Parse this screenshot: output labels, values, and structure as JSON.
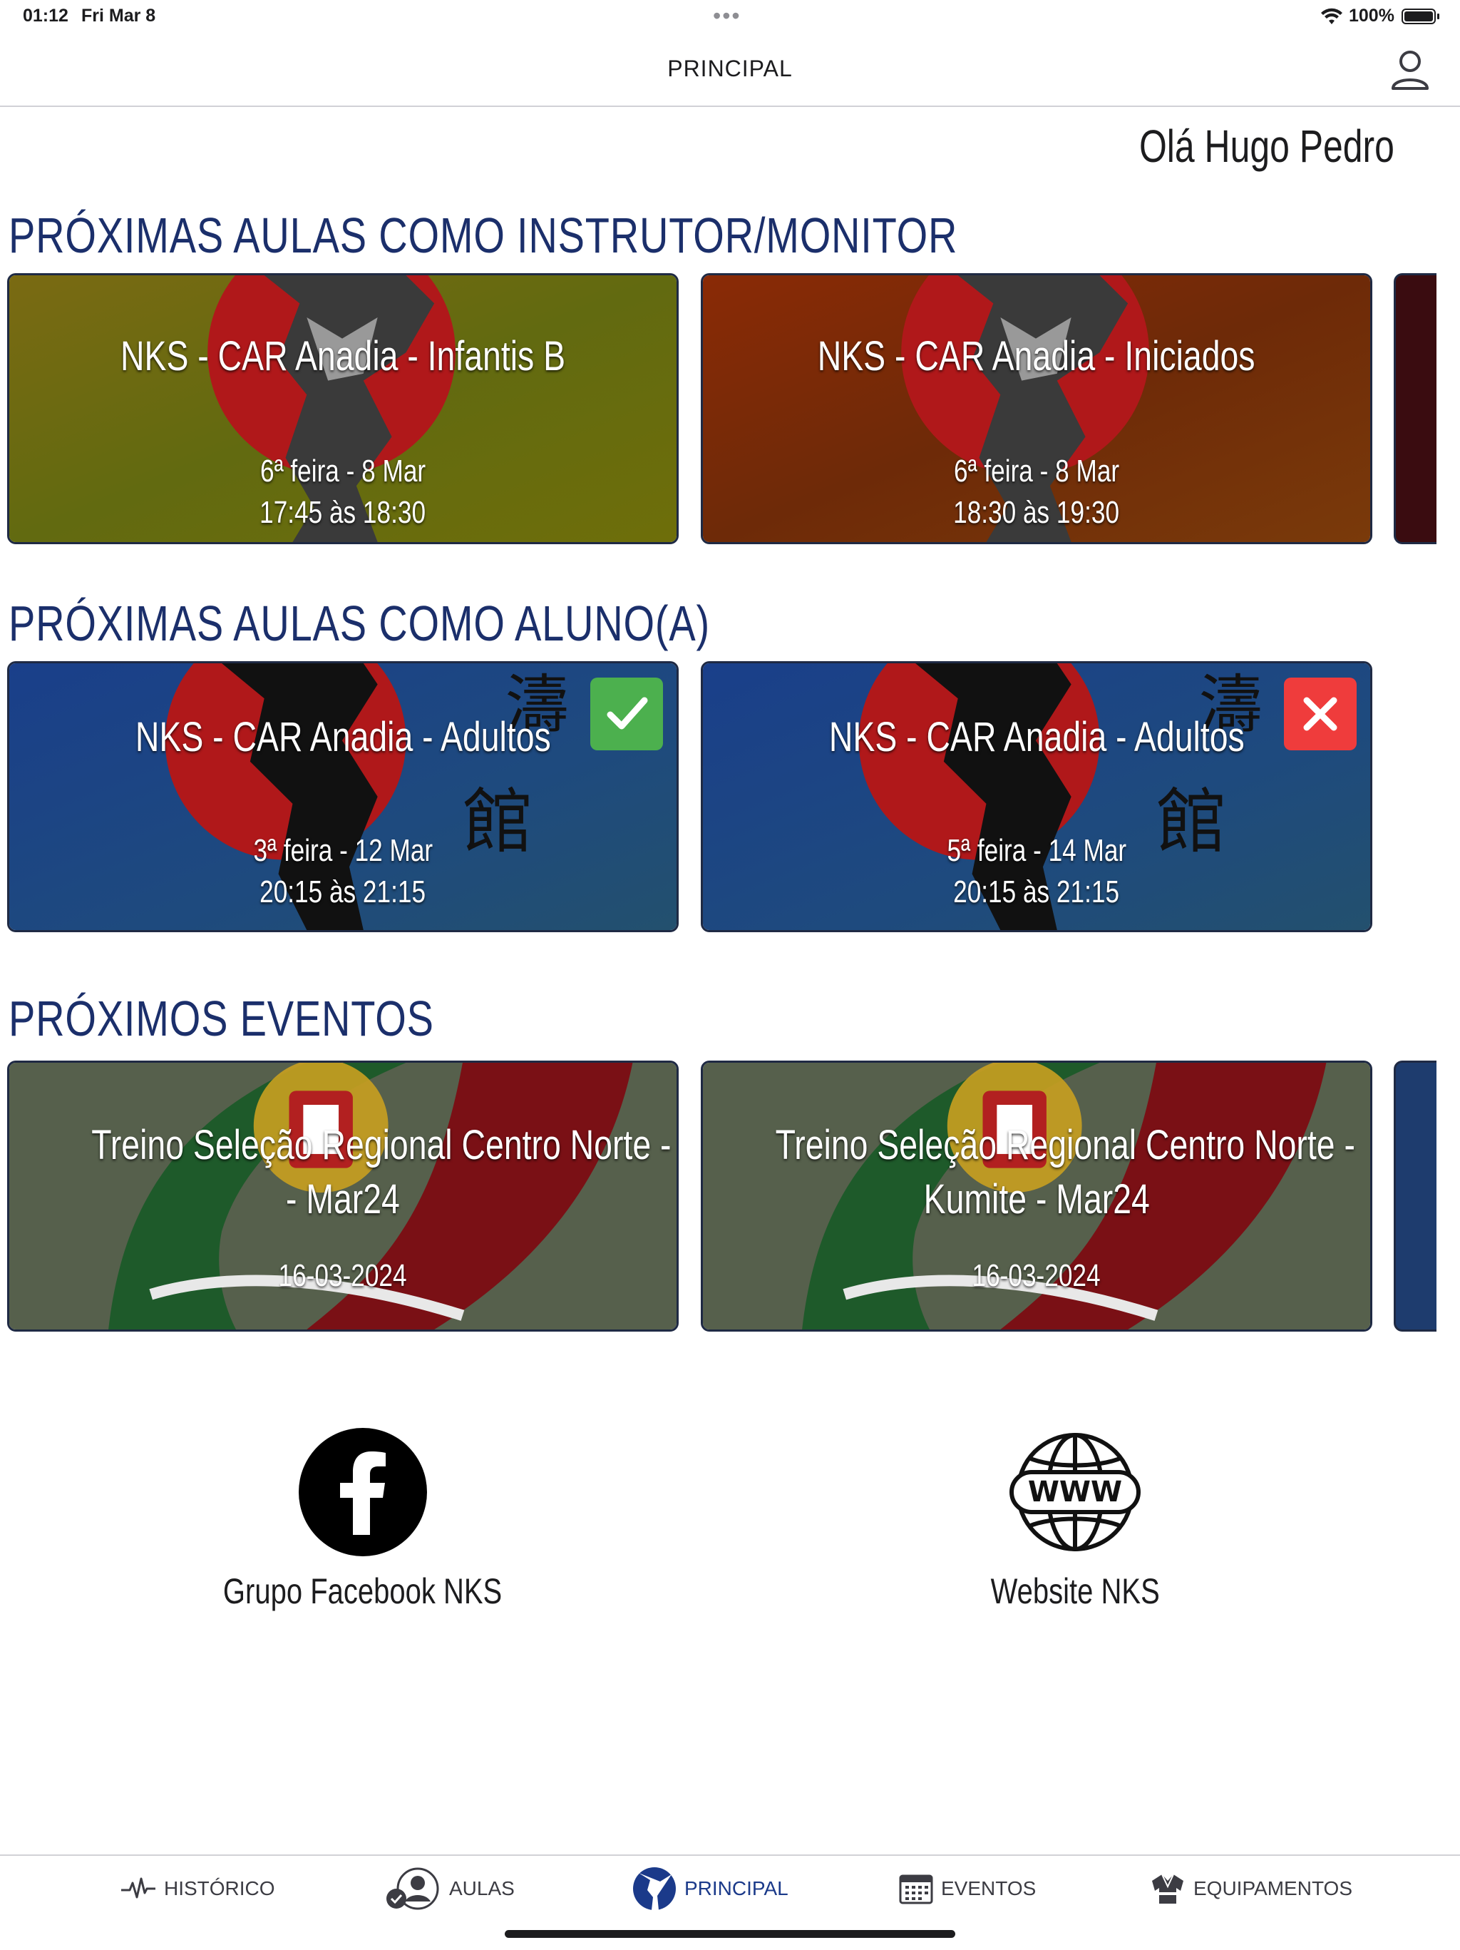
{
  "status_bar": {
    "time": "01:12",
    "date": "Fri Mar 8",
    "battery": "100%"
  },
  "nav": {
    "title": "PRINCIPAL"
  },
  "greeting": "Olá Hugo Pedro",
  "instructor_section": {
    "title": "PRÓXIMAS AULAS COMO INSTRUTOR/MONITOR",
    "cards": [
      {
        "title": "NKS - CAR Anadia - Infantis B",
        "day": "6ª feira - 8 Mar",
        "time": "17:45 às 18:30",
        "color": "#6b6d0c"
      },
      {
        "title": "NKS - CAR Anadia - Iniciados",
        "day": "6ª feira - 8 Mar",
        "time": "18:30 às 19:30",
        "color": "#7a2a06"
      }
    ]
  },
  "student_section": {
    "title": "PRÓXIMAS AULAS COMO ALUNO(A)",
    "cards": [
      {
        "title": "NKS - CAR Anadia - Adultos",
        "day": "3ª feira - 12 Mar",
        "time": "20:15 às 21:15",
        "status": "confirmed",
        "status_color": "#4cb04e"
      },
      {
        "title": "NKS - CAR Anadia - Adultos",
        "day": "5ª feira - 14 Mar",
        "time": "20:15 às 21:15",
        "status": "declined",
        "status_color": "#ef3c3c"
      }
    ]
  },
  "events_section": {
    "title": "PRÓXIMOS EVENTOS",
    "cards": [
      {
        "title_line1": "Treino Seleção Regional Centro Norte - Kata",
        "title_line2": "- Mar24",
        "date": "16-03-2024"
      },
      {
        "title_line1": "Treino Seleção Regional Centro Norte -",
        "title_line2": "Kumite - Mar24",
        "date": "16-03-2024"
      }
    ]
  },
  "links": {
    "facebook": {
      "label": "Grupo Facebook NKS",
      "icon": "facebook-icon"
    },
    "website": {
      "label": "Website NKS",
      "icon": "globe-www-icon",
      "icon_text": "WWW"
    }
  },
  "tabs": [
    {
      "label": "HISTÓRICO",
      "icon": "pulse-icon"
    },
    {
      "label": "AULAS",
      "icon": "user-check-icon"
    },
    {
      "label": "PRINCIPAL",
      "icon": "karate-logo-icon",
      "active": true
    },
    {
      "label": "EVENTOS",
      "icon": "calendar-icon"
    },
    {
      "label": "EQUIPAMENTOS",
      "icon": "uniform-icon"
    }
  ],
  "colors": {
    "accent": "#1b2f6b",
    "active_tab": "#1b3a8a"
  }
}
